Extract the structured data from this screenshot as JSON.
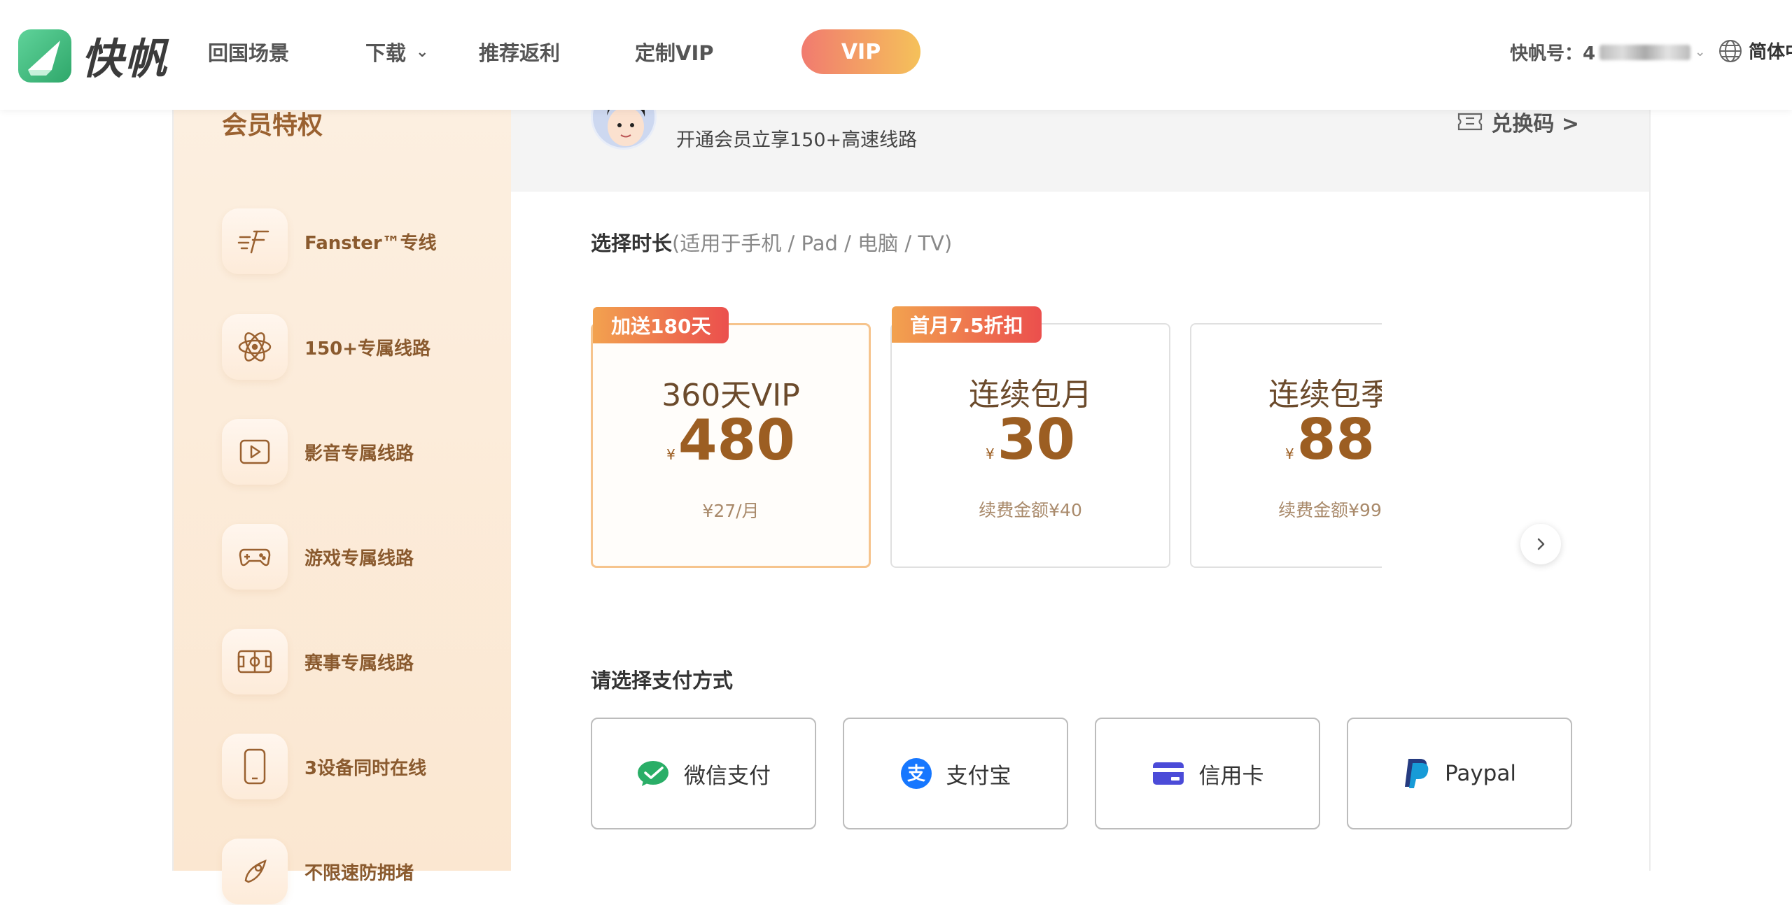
{
  "header": {
    "brand": "快帆",
    "nav": [
      {
        "label": "回国场景"
      },
      {
        "label": "下载",
        "chevron": "⌄"
      },
      {
        "label": "推荐返利"
      },
      {
        "label": "定制VIP"
      }
    ],
    "vip_label": "VIP",
    "account_label": "快帆号：4",
    "language_label": "简体中文",
    "accent_gradient": [
      "#f17b6f",
      "#f5c15a"
    ]
  },
  "sidebar": {
    "title": "会员特权",
    "perks": [
      {
        "label": "Fanster™专线",
        "icon": "fanster-icon"
      },
      {
        "label": "150+专属线路",
        "icon": "atom-icon"
      },
      {
        "label": "影音专属线路",
        "icon": "play-icon"
      },
      {
        "label": "游戏专属线路",
        "icon": "gamepad-icon"
      },
      {
        "label": "赛事专属线路",
        "icon": "field-icon"
      },
      {
        "label": "3设备同时在线",
        "icon": "phone-icon"
      },
      {
        "label": "不限速防拥堵",
        "icon": "rocket-icon"
      }
    ]
  },
  "user": {
    "subtitle": "开通会员立享150+高速线路",
    "redeem_label": "兑换码 >"
  },
  "duration": {
    "title": "选择时长",
    "hint": "(适用于手机 / Pad / 电脑 / TV)"
  },
  "plans": [
    {
      "tag": "加送180天",
      "name": "360天VIP",
      "currency": "¥",
      "price": "480",
      "note": "¥27/月",
      "selected": true
    },
    {
      "tag": "首月7.5折扣",
      "name": "连续包月",
      "currency": "¥",
      "price": "30",
      "note": "续费金额¥40",
      "selected": false
    },
    {
      "tag": "",
      "name": "连续包季",
      "currency": "¥",
      "price": "88",
      "note": "续费金额¥99",
      "selected": false
    }
  ],
  "payment": {
    "title": "请选择支付方式",
    "methods": [
      {
        "label": "微信支付",
        "icon": "wechat-pay-icon",
        "color": "#2aae67"
      },
      {
        "label": "支付宝",
        "icon": "alipay-icon",
        "color": "#1677ff"
      },
      {
        "label": "信用卡",
        "icon": "credit-card-icon",
        "color": "#4b4bd8"
      },
      {
        "label": "Paypal",
        "icon": "paypal-icon",
        "color": "#253b80"
      }
    ]
  },
  "colors": {
    "brand_green": "#3cbb7c",
    "perk_brown": "#8a5a2e",
    "price_brown": "#9c5e22",
    "tag_gradient": [
      "#f2a24f",
      "#eb4f4d"
    ]
  }
}
